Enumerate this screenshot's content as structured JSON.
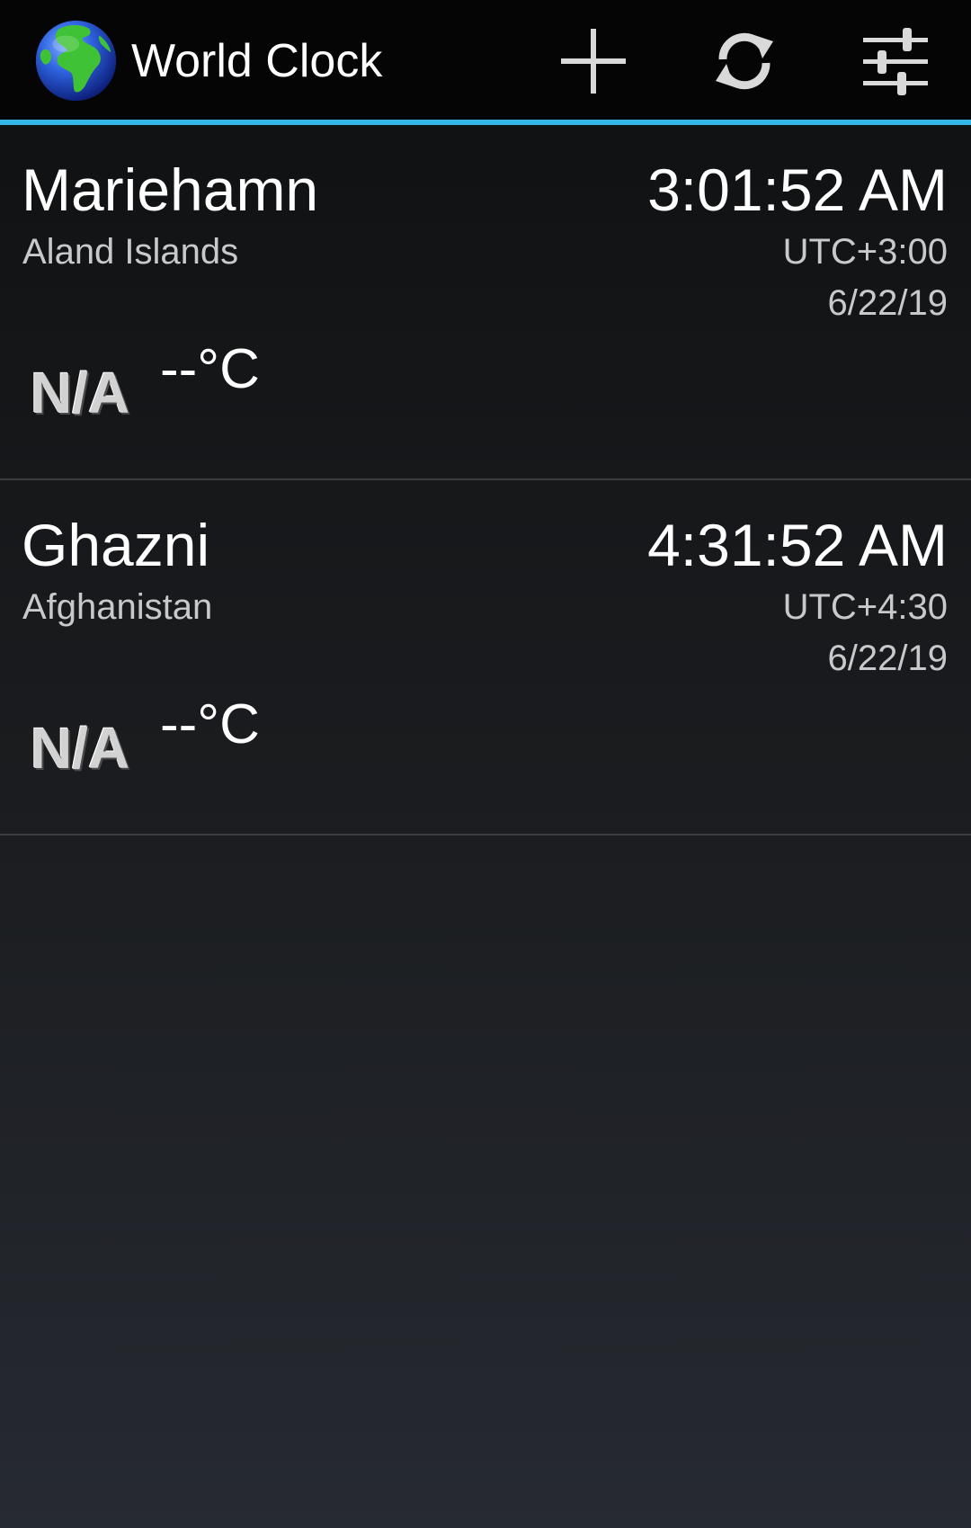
{
  "app": {
    "title": "World Clock",
    "accent_color": "#33b5e5",
    "icon": "globe-icon"
  },
  "actions": [
    {
      "name": "add",
      "icon": "plus-icon"
    },
    {
      "name": "refresh",
      "icon": "refresh-icon"
    },
    {
      "name": "settings",
      "icon": "sliders-icon"
    }
  ],
  "clocks": [
    {
      "city": "Mariehamn",
      "country": "Aland Islands",
      "time": "3:01:52 AM",
      "utc": "UTC+3:00",
      "date": "6/22/19",
      "weather": "N/A",
      "temperature": "--°C"
    },
    {
      "city": "Ghazni",
      "country": "Afghanistan",
      "time": "4:31:52 AM",
      "utc": "UTC+4:30",
      "date": "6/22/19",
      "weather": "N/A",
      "temperature": "--°C"
    }
  ]
}
